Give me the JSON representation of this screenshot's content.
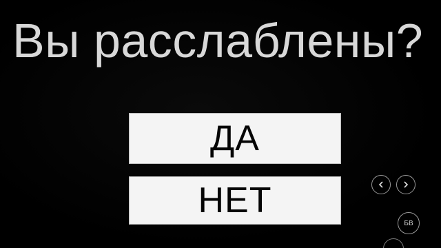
{
  "question": "Вы расслаблены?",
  "answers": {
    "yes": "ДА",
    "no": "НЕТ"
  },
  "controls": {
    "prev_icon": "chevron-left-icon",
    "next_icon": "chevron-right-icon",
    "bv_label": "БВ"
  },
  "colors": {
    "background": "#000000",
    "question_text": "#d8d8d8",
    "button_fill": "#f4f4f4",
    "button_text": "#050505",
    "control_outline": "#9a9a9a"
  }
}
